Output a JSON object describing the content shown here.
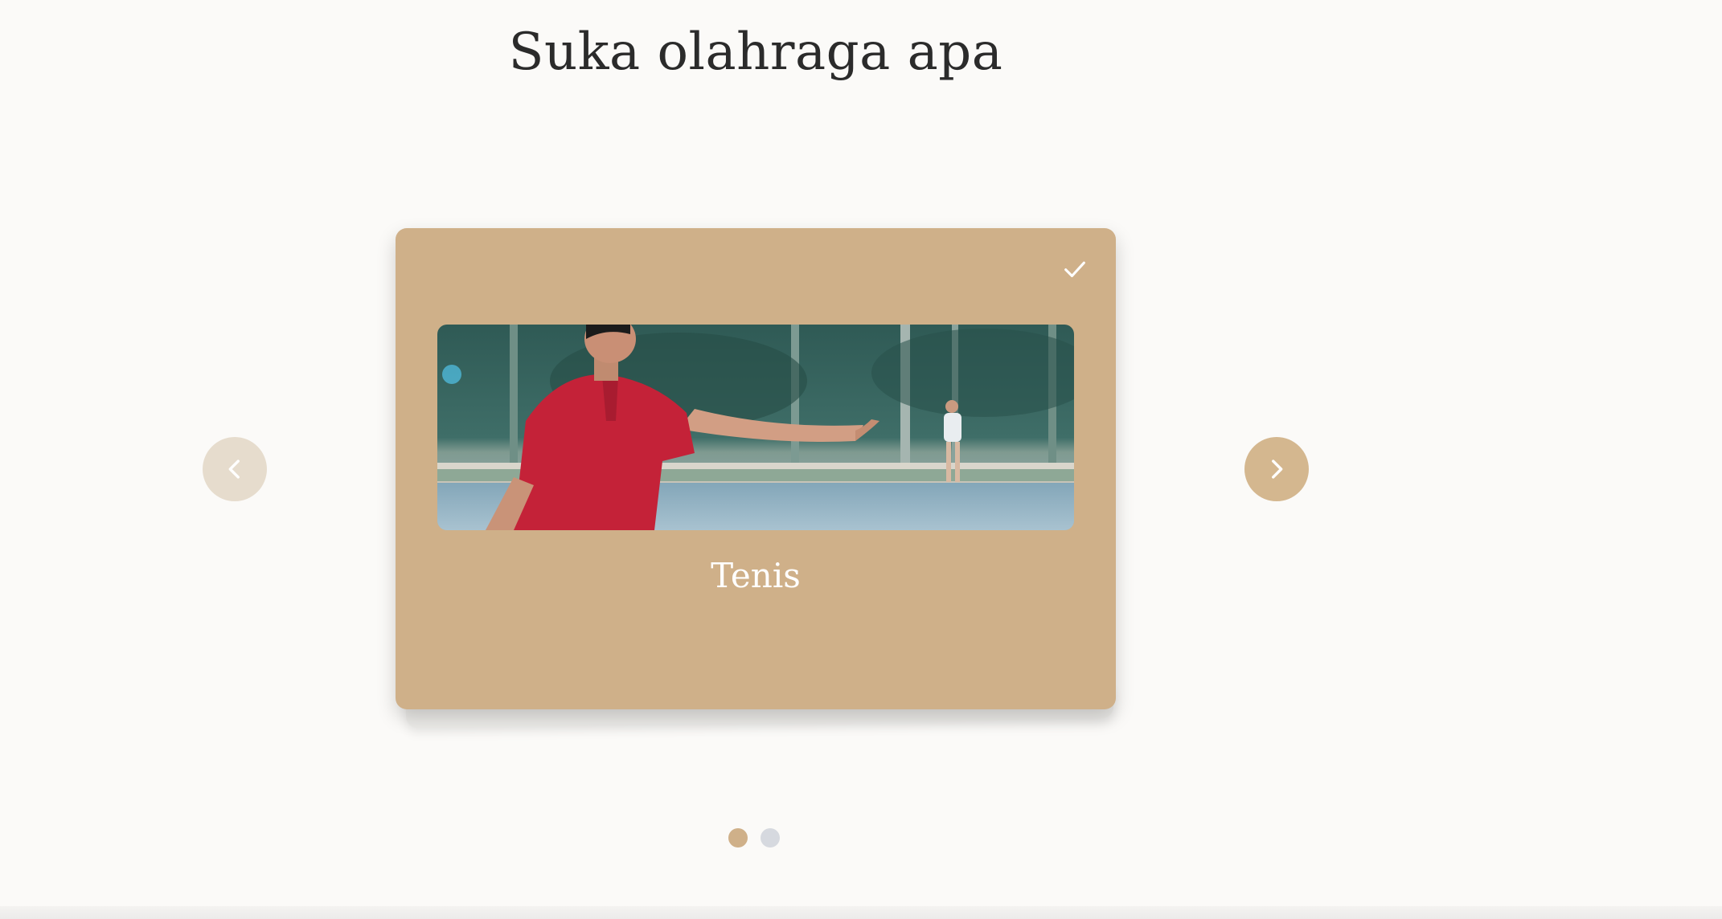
{
  "header": {
    "title": "Suka olahraga apa"
  },
  "carousel": {
    "card": {
      "label": "Tenis",
      "selected": true,
      "icon": "check-icon",
      "image_icon": "tennis-player-photo"
    },
    "prev_icon": "chevron-left-icon",
    "next_icon": "chevron-right-icon",
    "pagination": {
      "total": 2,
      "active_index": 0
    }
  },
  "colors": {
    "accent": "#cfb089",
    "background": "#fbfaf8",
    "inactive_dot": "#d6d9df"
  }
}
